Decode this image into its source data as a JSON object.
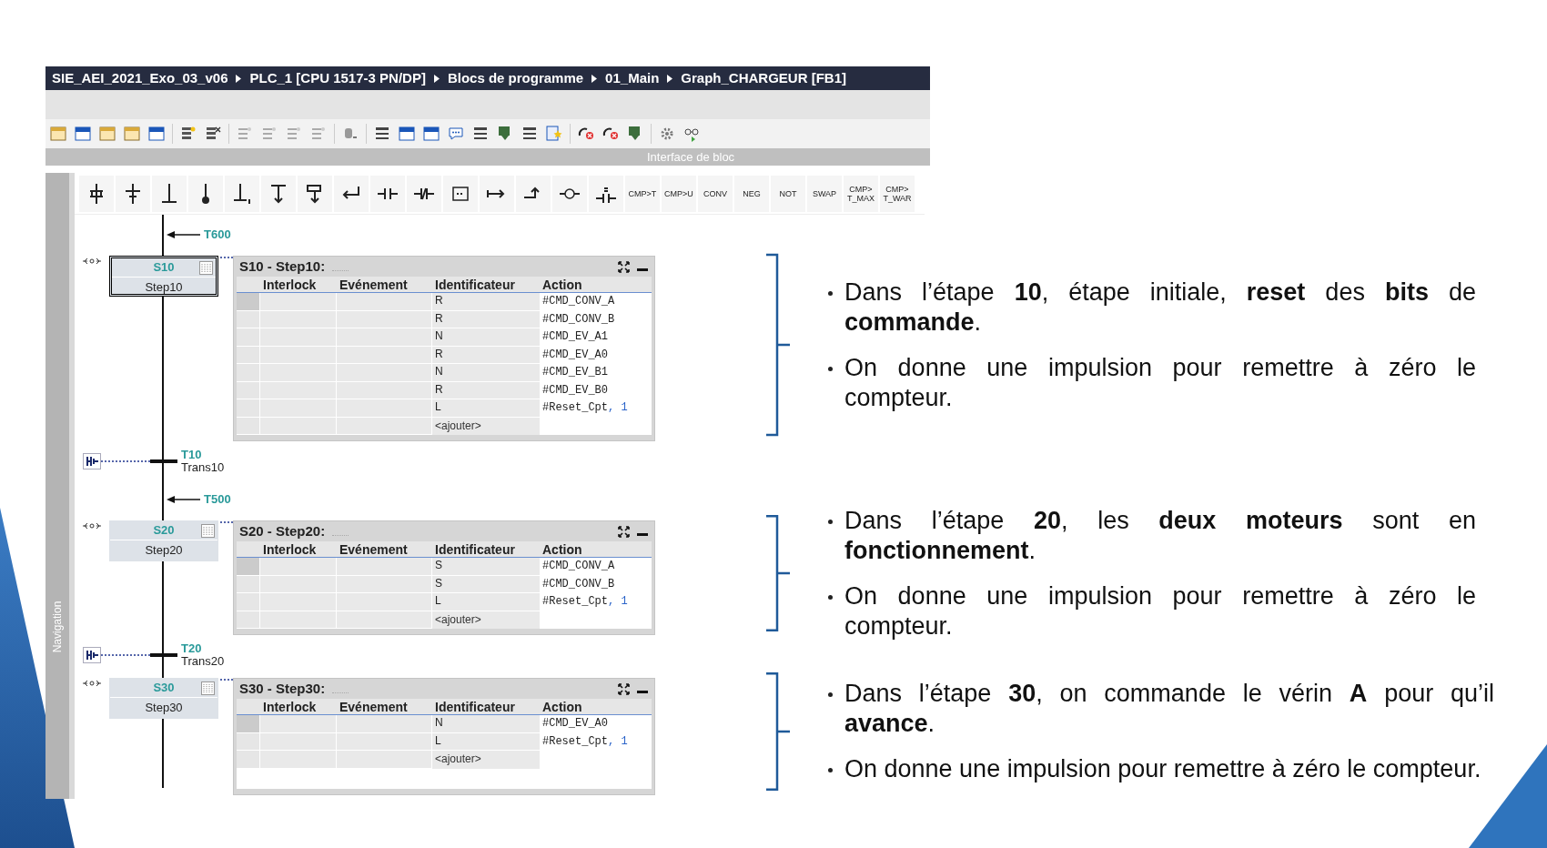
{
  "breadcrumb": [
    "SIE_AEI_2021_Exo_03_v06",
    "PLC_1 [CPU 1517-3 PN/DP]",
    "Blocs de programme",
    "01_Main",
    "Graph_CHARGEUR [FB1]"
  ],
  "interface_bar": {
    "label": "Interface de bloc"
  },
  "instruction_buttons": [
    {
      "lines": [
        "CMP>T"
      ]
    },
    {
      "lines": [
        "CMP>U"
      ]
    },
    {
      "lines": [
        "CONV"
      ]
    },
    {
      "lines": [
        "NEG"
      ]
    },
    {
      "lines": [
        "NOT"
      ]
    },
    {
      "lines": [
        "SWAP"
      ]
    },
    {
      "lines": [
        "CMP>",
        "T_MAX"
      ]
    },
    {
      "lines": [
        "CMP>",
        "T_WAR"
      ]
    }
  ],
  "navigation": {
    "label": "Navigation"
  },
  "graph": [
    {
      "kind": "jump",
      "label": "T600"
    },
    {
      "kind": "step",
      "number": "S10",
      "name": "Step10",
      "initial": true,
      "title": "S10 - Step10:",
      "columns": [
        "Interlock",
        "Evénement",
        "Identificateur",
        "Action"
      ],
      "rows": [
        {
          "qualifier": "R",
          "action": "#CMD_CONV_A"
        },
        {
          "qualifier": "R",
          "action": "#CMD_CONV_B"
        },
        {
          "qualifier": "N",
          "action": "#CMD_EV_A1"
        },
        {
          "qualifier": "R",
          "action": "#CMD_EV_A0"
        },
        {
          "qualifier": "N",
          "action": "#CMD_EV_B1"
        },
        {
          "qualifier": "R",
          "action": "#CMD_EV_B0"
        },
        {
          "qualifier": "L",
          "action": "#Reset_Cpt",
          "argument": ", 1"
        }
      ],
      "add_label": "<ajouter>"
    },
    {
      "kind": "transition",
      "number": "T10",
      "name": "Trans10"
    },
    {
      "kind": "jump",
      "label": "T500"
    },
    {
      "kind": "step",
      "number": "S20",
      "name": "Step20",
      "initial": false,
      "title": "S20 - Step20:",
      "columns": [
        "Interlock",
        "Evénement",
        "Identificateur",
        "Action"
      ],
      "rows": [
        {
          "qualifier": "S",
          "action": "#CMD_CONV_A"
        },
        {
          "qualifier": "S",
          "action": "#CMD_CONV_B"
        },
        {
          "qualifier": "L",
          "action": "#Reset_Cpt",
          "argument": ", 1"
        }
      ],
      "add_label": "<ajouter>"
    },
    {
      "kind": "transition",
      "number": "T20",
      "name": "Trans20"
    },
    {
      "kind": "step",
      "number": "S30",
      "name": "Step30",
      "initial": false,
      "title": "S30 - Step30:",
      "columns": [
        "Interlock",
        "Evénement",
        "Identificateur",
        "Action"
      ],
      "rows": [
        {
          "qualifier": "N",
          "action": "#CMD_EV_A0"
        },
        {
          "qualifier": "L",
          "action": "#Reset_Cpt",
          "argument": ", 1"
        }
      ],
      "add_label": "<ajouter>"
    }
  ],
  "notes": [
    {
      "bullets": [
        "Dans l’étape **10**, étape initiale, **reset** des **bits** de **commande**.",
        "On donne une impulsion pour remettre à zéro le compteur."
      ]
    },
    {
      "bullets": [
        "Dans l’étape **20**, les **deux moteurs** sont en **fonctionnement**.",
        "On donne une impulsion pour remettre à zéro le compteur."
      ]
    },
    {
      "bullets": [
        "Dans l’étape **30**, on commande le vérin **A** pour qu’il **avance**.",
        "On donne une impulsion pour remettre à zéro le compteur."
      ]
    }
  ]
}
